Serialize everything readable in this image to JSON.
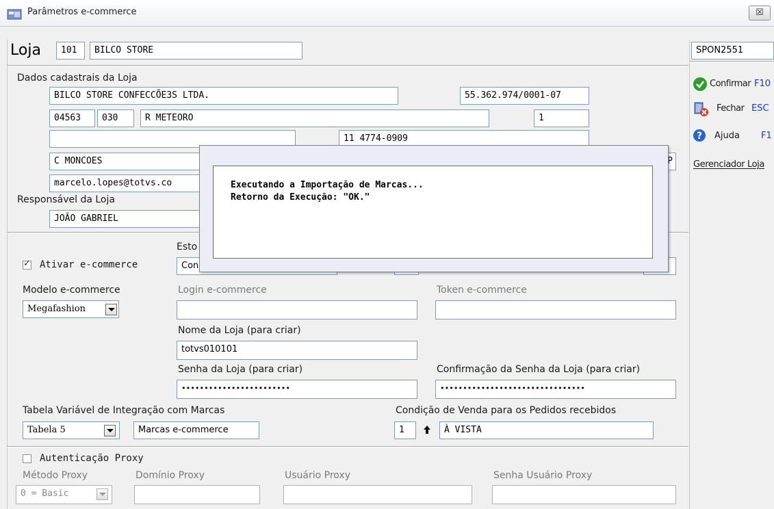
{
  "window": {
    "title": "Parâmetros e-commerce",
    "close_symbol": "☒"
  },
  "store": {
    "label": "Loja",
    "code": "101",
    "name": "BILCO STORE",
    "section_label": "Dados cadastrais da Loja",
    "company_name": "BILCO STORE CONFECCÕE3S LTDA.",
    "cnpj": "55.362.974/0001-07",
    "cep1": "04563",
    "cep2": "030",
    "street": "R METEORO",
    "number": "1",
    "complement": "",
    "phone": "11 4774-0909",
    "district": "C MONCOES",
    "state_partial": "P",
    "email": "marcelo.lopes@totvs.co",
    "responsible_label": "Responsável da Loja",
    "responsible": "JOÃO GABRIEL"
  },
  "ecommerce": {
    "stock_label_partial": "Esto",
    "stock_value_partial": "Con",
    "activate_label": "Ativar e-commerce",
    "model_label": "Modelo e-commerce",
    "model_value": "Megafashion",
    "login_label": "Login e-commerce",
    "login_value": "",
    "token_label": "Token e-commerce",
    "token_value": "",
    "store_name_label": "Nome da Loja (para criar)",
    "store_name_value": "totvs010101",
    "password_label": "Senha da Loja (para criar)",
    "password_value": "••••••••••••••••••••••••",
    "confirm_password_label": "Confirmação da Senha da Loja (para criar)",
    "confirm_password_value": "••••••••••••••••••••••••••••••••",
    "brand_table_label": "Tabela Variável de Integração com Marcas",
    "brand_table_value": "Tabela 5",
    "brand_table_desc": "Marcas e-commerce",
    "sale_condition_label": "Condição de Venda para os Pedidos recebidos",
    "sale_condition_code": "1",
    "sale_condition_desc": "À VISTA"
  },
  "proxy": {
    "auth_label": "Autenticação Proxy",
    "method_label": "Método Proxy",
    "method_value": "0 = Basic",
    "domain_label": "Domínio Proxy",
    "user_label": "Usuário Proxy",
    "password_label": "Senha Usuário Proxy"
  },
  "sidebar": {
    "code": "SPON2551",
    "confirm_label": "Confirmar",
    "confirm_key": "F10",
    "close_label": "Fechar",
    "close_key": "ESC",
    "help_label": "Ajuda",
    "help_key": "F1",
    "manager_label": "Gerenciador Loja"
  },
  "dialog": {
    "line1": "Executando a Importação de Marcas...",
    "line2": "Retorno da Execução: \"OK.\""
  },
  "colors": {
    "confirm_green": "#2e9e2e",
    "help_blue": "#2a64c8",
    "close_red": "#d23a2a",
    "key_blue": "#1a3bd1"
  }
}
